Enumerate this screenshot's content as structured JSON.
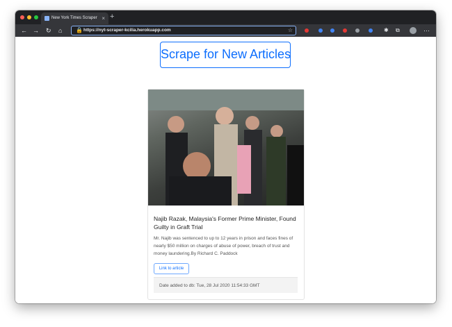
{
  "browser": {
    "tab_title": "New York Times Scraper",
    "tab_close": "×",
    "new_tab": "+",
    "url": "https://nyt-scraper-kcilia.herokuapp.com",
    "icons": {
      "back": "back-icon",
      "forward": "forward-icon",
      "reload": "reload-icon",
      "home": "home-icon",
      "lock": "lock-icon",
      "star": "star-icon",
      "menu": "more-icon"
    },
    "traffic_light_colors": [
      "#ff5f57",
      "#febc2e",
      "#28c840"
    ]
  },
  "page": {
    "scrape_button_label": "Scrape for New Articles",
    "articles": [
      {
        "headline": "Najib Razak, Malaysia's Former Prime Minister, Found Guilty in Graft Trial",
        "summary": "Mr. Najib was sentenced to up to 12 years in prison and faces fines of nearly $50 million on charges of abuse of power, breach of trust and money laundering.By Richard C. Paddock",
        "link_label": "Link to article",
        "date_added": "Date added to db: Tue, 28 Jul 2020 11:54:33 GMT"
      }
    ]
  },
  "colors": {
    "accent": "#0d6efd",
    "titlebar": "#202124",
    "toolbar": "#35363a"
  }
}
